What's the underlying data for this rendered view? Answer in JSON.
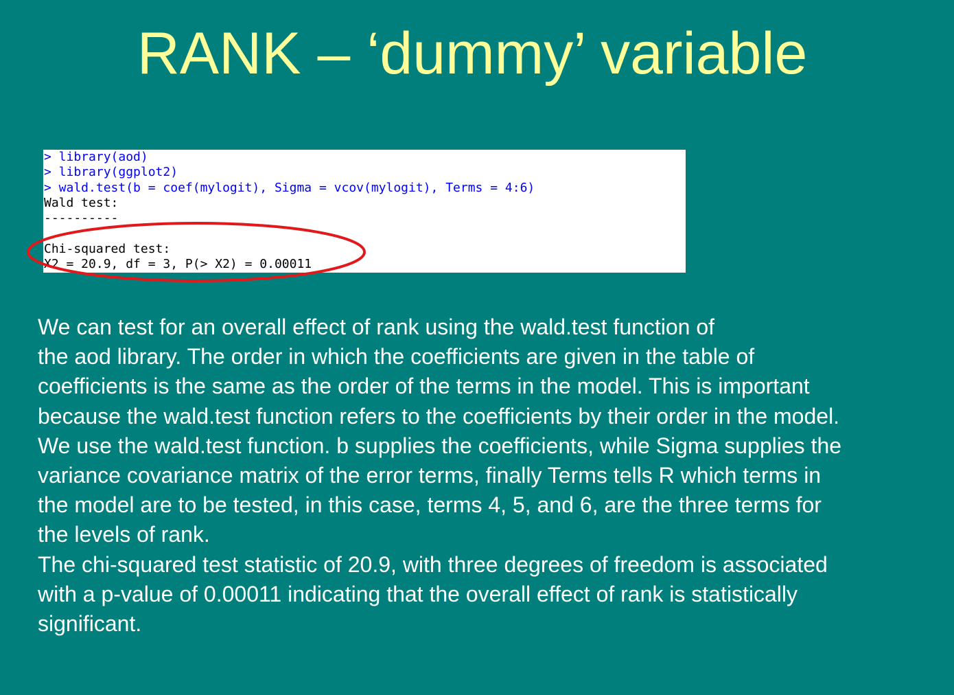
{
  "slide": {
    "title": "RANK – ‘dummy’ variable"
  },
  "console": {
    "lines": [
      {
        "kind": "cmd",
        "text": "> library(aod)"
      },
      {
        "kind": "cmd",
        "text": "> library(ggplot2)"
      },
      {
        "kind": "cmd",
        "text": "> wald.test(b = coef(mylogit), Sigma = vcov(mylogit), Terms = 4:6)"
      },
      {
        "kind": "out",
        "text": "Wald test:"
      },
      {
        "kind": "out",
        "text": "----------"
      },
      {
        "kind": "out",
        "text": ""
      },
      {
        "kind": "out",
        "text": "Chi-squared test:"
      },
      {
        "kind": "out",
        "text": "X2 = 20.9, df = 3, P(> X2) = 0.00011"
      }
    ],
    "highlight_color": "#e01a1a"
  },
  "body": {
    "lines": [
      "We can test for an overall effect of rank using the wald.test function of",
      "the aod library. The order in which the coefficients are given in the table of",
      "coefficients is the same as the order of the terms in the model. This is important",
      "because the wald.test function refers to the coefficients by their order in the model.",
      "We use the wald.test function. b supplies the coefficients, while Sigma supplies the",
      "variance covariance matrix of the error terms, finally Terms tells R which terms in",
      "the model are to be tested, in this case, terms 4, 5, and 6, are the three terms for",
      "the levels of rank.",
      "The chi-squared test statistic of 20.9, with three degrees of freedom is associated",
      "with a p-value of 0.00011 indicating that the overall effect of rank is statistically",
      "significant."
    ]
  },
  "colors": {
    "background": "#007f7c",
    "title": "#ffff99",
    "body_text": "#ffffff",
    "command": "#0000ff"
  }
}
